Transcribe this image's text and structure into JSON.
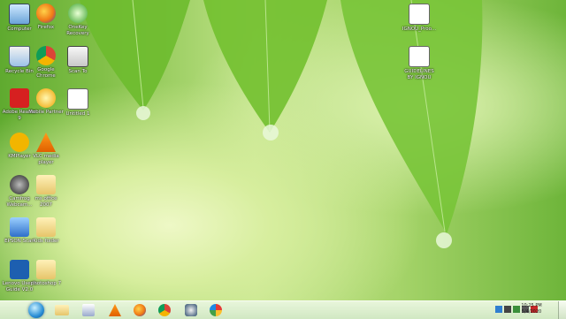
{
  "desktop": {
    "icons": [
      {
        "label": "Computer",
        "icon": "computer-icon"
      },
      {
        "label": "Firefox",
        "icon": "firefox-icon"
      },
      {
        "label": "OneKey Recovery",
        "icon": "onekey-recovery-icon"
      },
      {
        "label": "Recycle Bin",
        "icon": "recycle-bin-icon"
      },
      {
        "label": "Google Chrome",
        "icon": "chrome-icon"
      },
      {
        "label": "Scan To",
        "icon": "scan-to-icon"
      },
      {
        "label": "Adobe Reader 9",
        "icon": "adobe-reader-icon"
      },
      {
        "label": "Mobile Partner",
        "icon": "mobile-partner-icon"
      },
      {
        "label": "Untitled 1",
        "icon": "document-icon"
      },
      {
        "label": "KMPlayer",
        "icon": "kmplayer-icon"
      },
      {
        "label": "VLC media player",
        "icon": "vlc-icon"
      },
      {
        "label": "Camfrog Webcam...",
        "icon": "webcam-icon"
      },
      {
        "label": "ms office 2007",
        "icon": "folder-icon"
      },
      {
        "label": "EPSON Scan",
        "icon": "epson-scan-icon"
      },
      {
        "label": "Kids folder",
        "icon": "folder-icon"
      },
      {
        "label": "Lenovo User's Guide V2.0",
        "icon": "user-guide-icon"
      },
      {
        "label": "photoshop 7",
        "icon": "folder-icon"
      },
      {
        "label": "IGNOU_Proo...",
        "icon": "pdf-document-icon"
      },
      {
        "label": "GUIDELINES BY IGNOU",
        "icon": "pdf-document-icon"
      }
    ]
  },
  "taskbar": {
    "apps": [
      {
        "name": "windows-explorer",
        "icon": "folder-icon"
      },
      {
        "name": "media-player",
        "icon": "media-player-icon"
      },
      {
        "name": "vlc",
        "icon": "vlc-icon"
      },
      {
        "name": "firefox",
        "icon": "firefox-icon"
      },
      {
        "name": "chrome",
        "icon": "chrome-icon"
      },
      {
        "name": "onekey",
        "icon": "onekey-icon"
      },
      {
        "name": "paint",
        "icon": "paint-icon"
      }
    ],
    "clock": {
      "time": "10:25 PM",
      "date": "5/4/2020"
    }
  }
}
